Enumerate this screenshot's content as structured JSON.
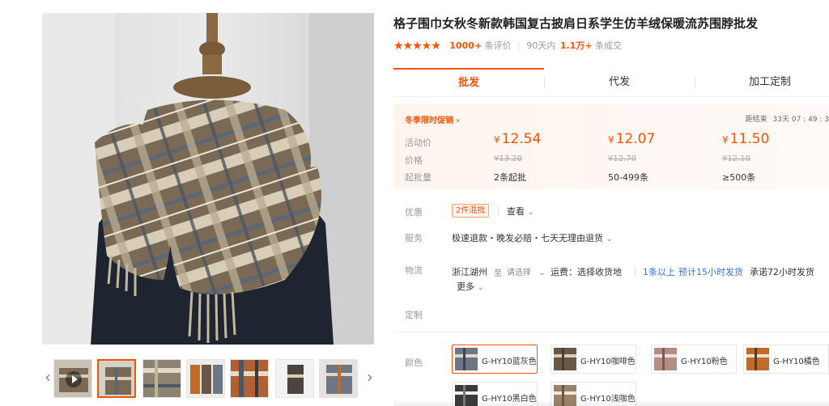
{
  "product": {
    "title": "格子围巾女秋冬新款韩国复古披肩日系学生仿羊绒保暖流苏围脖批发",
    "rating_count": "1000+",
    "rating_suffix": "条评价",
    "sales_period": "90天内",
    "sales_count": "1.1万+",
    "sales_suffix": "条成交"
  },
  "tabs": [
    {
      "label": "批发",
      "active": true
    },
    {
      "label": "代发",
      "active": false
    },
    {
      "label": "加工定制",
      "active": false
    }
  ],
  "promo": {
    "title": "冬季限时促销",
    "chevron": "›",
    "countdown_label": "距结束",
    "countdown_value": "33天 07 : 49 : 3"
  },
  "price_table": {
    "row_labels": {
      "current": "活动价",
      "original": "价格",
      "moq": "起批量"
    },
    "tiers": [
      {
        "current": "12.54",
        "original": "¥13.20",
        "moq": "2条起批"
      },
      {
        "current": "12.07",
        "original": "¥12.70",
        "moq": "50-499条"
      },
      {
        "current": "11.50",
        "original": "¥12.10",
        "moq": "≥500条"
      }
    ],
    "currency": "¥"
  },
  "attributes": {
    "discount_label": "优惠",
    "discount_tag": "2件混批",
    "discount_view": "查看",
    "service_label": "服务",
    "service_value": "极速退款・晚发必赔・七天无理由退货",
    "logistics_label": "物流",
    "ship_from": "浙江湖州",
    "ship_to_word": "至",
    "ship_to_select": "请选择",
    "freight_label": "运费：选择收货地",
    "dispatch_qty": "1条以上",
    "dispatch_eta": "预计15小时发货",
    "promise": "承诺72小时发货",
    "more": "更多",
    "custom_label": "定制",
    "color_label": "颜色"
  },
  "colors": [
    {
      "name": "G-HY10蓝灰色",
      "selected": true,
      "swatch": "#6d7684"
    },
    {
      "name": "G-HY10咖啡色",
      "selected": false,
      "swatch": "#6b5747"
    },
    {
      "name": "G-HY10粉色",
      "selected": false,
      "swatch": "#b48d85"
    },
    {
      "name": "G-HY10橘色",
      "selected": false,
      "swatch": "#c06b2a"
    },
    {
      "name": "G-HY10黑白色",
      "selected": false,
      "swatch": "#3a3a3a"
    },
    {
      "name": "G-HY10浅咖色",
      "selected": false,
      "swatch": "#9a8369"
    }
  ],
  "icons": {
    "arrow_left": "‹",
    "arrow_right": "›",
    "chevron_down": "⌄",
    "stars": "★★★★★"
  },
  "colors_theme": {
    "accent": "#ff5000",
    "link": "#3a6fd8"
  }
}
